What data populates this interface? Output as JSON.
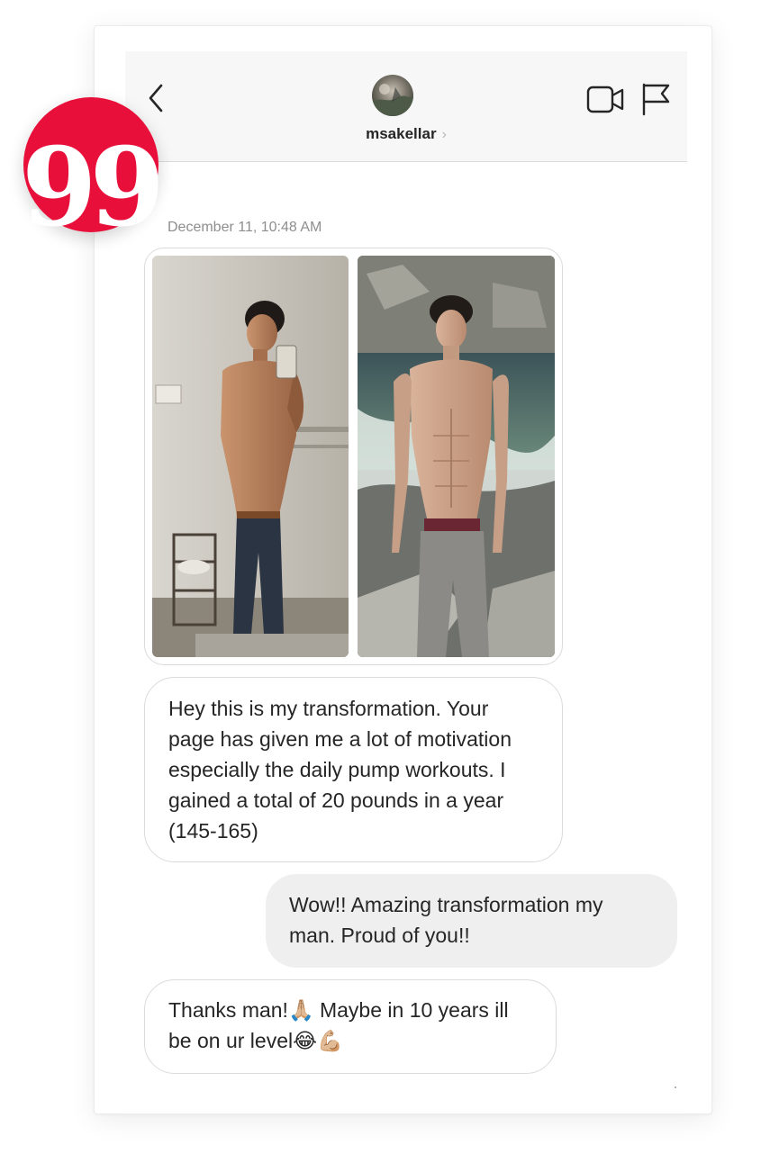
{
  "header": {
    "username": "msakellar",
    "chevron": "›",
    "icons": {
      "back": "chevron-left-icon",
      "video": "video-camera-icon",
      "flag": "flag-icon"
    }
  },
  "badge": {
    "glyph": "99",
    "color": "#e8103a"
  },
  "conversation": {
    "timestamp": "December 11, 10:48 AM",
    "messages": [
      {
        "from": "msakellar",
        "text": "Hey this is my transformation. Your page has given me a lot of motivation especially the daily pump workouts. I gained a total of 20 pounds in a year (145-165)"
      },
      {
        "from": "me",
        "text": "Wow!! Amazing transformation my man. Proud of you!!"
      },
      {
        "from": "msakellar",
        "text": "Thanks man!🙏🏼 Maybe in 10 years ill be on ur level😂💪🏼"
      }
    ]
  },
  "colors": {
    "accent": "#e8103a",
    "incoming_bubble": "#ffffff",
    "outgoing_bubble": "#efefef",
    "header_bg": "#f7f7f7",
    "text": "#262626",
    "muted": "#8e8e8e"
  }
}
